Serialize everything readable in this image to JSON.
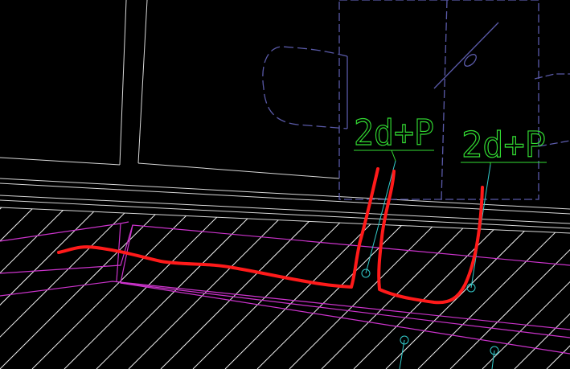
{
  "canvas": {
    "background": "#000000",
    "description_colors": {
      "walls": "#d8d8d8",
      "hatch": "#ffffff",
      "curb": "#cc33cc",
      "fixtures": "#5a5aa8",
      "labels": "#33dd33",
      "leaders": "#33cccc",
      "markup": "#ff1a1a"
    }
  },
  "labels": {
    "tag_left": "2d+P",
    "tag_right": "2d+P"
  },
  "markup": {
    "type": "freehand-red-redline"
  }
}
